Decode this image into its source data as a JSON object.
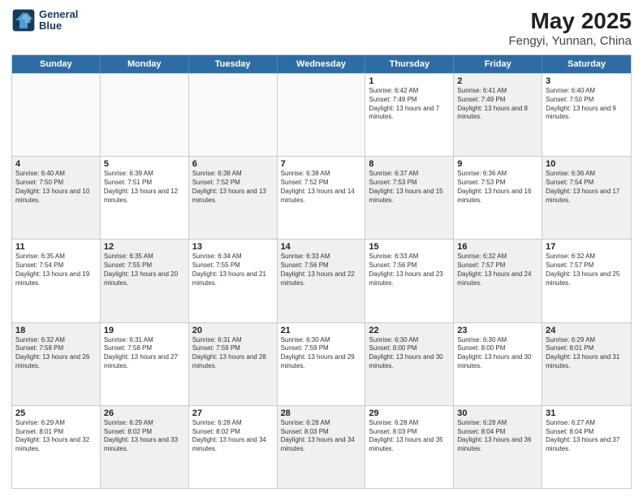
{
  "header": {
    "logo_line1": "General",
    "logo_line2": "Blue",
    "title": "May 2025",
    "subtitle": "Fengyi, Yunnan, China"
  },
  "weekdays": [
    "Sunday",
    "Monday",
    "Tuesday",
    "Wednesday",
    "Thursday",
    "Friday",
    "Saturday"
  ],
  "rows": [
    [
      {
        "day": "",
        "info": "",
        "empty": true
      },
      {
        "day": "",
        "info": "",
        "empty": true
      },
      {
        "day": "",
        "info": "",
        "empty": true
      },
      {
        "day": "",
        "info": "",
        "empty": true
      },
      {
        "day": "1",
        "info": "Sunrise: 6:42 AM\nSunset: 7:49 PM\nDaylight: 13 hours and 7 minutes.",
        "shaded": false
      },
      {
        "day": "2",
        "info": "Sunrise: 6:41 AM\nSunset: 7:49 PM\nDaylight: 13 hours and 8 minutes.",
        "shaded": true
      },
      {
        "day": "3",
        "info": "Sunrise: 6:40 AM\nSunset: 7:50 PM\nDaylight: 13 hours and 9 minutes.",
        "shaded": false
      }
    ],
    [
      {
        "day": "4",
        "info": "Sunrise: 6:40 AM\nSunset: 7:50 PM\nDaylight: 13 hours and 10 minutes.",
        "shaded": true
      },
      {
        "day": "5",
        "info": "Sunrise: 6:39 AM\nSunset: 7:51 PM\nDaylight: 13 hours and 12 minutes.",
        "shaded": false
      },
      {
        "day": "6",
        "info": "Sunrise: 6:38 AM\nSunset: 7:52 PM\nDaylight: 13 hours and 13 minutes.",
        "shaded": true
      },
      {
        "day": "7",
        "info": "Sunrise: 6:38 AM\nSunset: 7:52 PM\nDaylight: 13 hours and 14 minutes.",
        "shaded": false
      },
      {
        "day": "8",
        "info": "Sunrise: 6:37 AM\nSunset: 7:53 PM\nDaylight: 13 hours and 15 minutes.",
        "shaded": true
      },
      {
        "day": "9",
        "info": "Sunrise: 6:36 AM\nSunset: 7:53 PM\nDaylight: 13 hours and 16 minutes.",
        "shaded": false
      },
      {
        "day": "10",
        "info": "Sunrise: 6:36 AM\nSunset: 7:54 PM\nDaylight: 13 hours and 17 minutes.",
        "shaded": true
      }
    ],
    [
      {
        "day": "11",
        "info": "Sunrise: 6:35 AM\nSunset: 7:54 PM\nDaylight: 13 hours and 19 minutes.",
        "shaded": false
      },
      {
        "day": "12",
        "info": "Sunrise: 6:35 AM\nSunset: 7:55 PM\nDaylight: 13 hours and 20 minutes.",
        "shaded": true
      },
      {
        "day": "13",
        "info": "Sunrise: 6:34 AM\nSunset: 7:55 PM\nDaylight: 13 hours and 21 minutes.",
        "shaded": false
      },
      {
        "day": "14",
        "info": "Sunrise: 6:33 AM\nSunset: 7:56 PM\nDaylight: 13 hours and 22 minutes.",
        "shaded": true
      },
      {
        "day": "15",
        "info": "Sunrise: 6:33 AM\nSunset: 7:56 PM\nDaylight: 13 hours and 23 minutes.",
        "shaded": false
      },
      {
        "day": "16",
        "info": "Sunrise: 6:32 AM\nSunset: 7:57 PM\nDaylight: 13 hours and 24 minutes.",
        "shaded": true
      },
      {
        "day": "17",
        "info": "Sunrise: 6:32 AM\nSunset: 7:57 PM\nDaylight: 13 hours and 25 minutes.",
        "shaded": false
      }
    ],
    [
      {
        "day": "18",
        "info": "Sunrise: 6:32 AM\nSunset: 7:58 PM\nDaylight: 13 hours and 26 minutes.",
        "shaded": true
      },
      {
        "day": "19",
        "info": "Sunrise: 6:31 AM\nSunset: 7:58 PM\nDaylight: 13 hours and 27 minutes.",
        "shaded": false
      },
      {
        "day": "20",
        "info": "Sunrise: 6:31 AM\nSunset: 7:59 PM\nDaylight: 13 hours and 28 minutes.",
        "shaded": true
      },
      {
        "day": "21",
        "info": "Sunrise: 6:30 AM\nSunset: 7:59 PM\nDaylight: 13 hours and 29 minutes.",
        "shaded": false
      },
      {
        "day": "22",
        "info": "Sunrise: 6:30 AM\nSunset: 8:00 PM\nDaylight: 13 hours and 30 minutes.",
        "shaded": true
      },
      {
        "day": "23",
        "info": "Sunrise: 6:30 AM\nSunset: 8:00 PM\nDaylight: 13 hours and 30 minutes.",
        "shaded": false
      },
      {
        "day": "24",
        "info": "Sunrise: 6:29 AM\nSunset: 8:01 PM\nDaylight: 13 hours and 31 minutes.",
        "shaded": true
      }
    ],
    [
      {
        "day": "25",
        "info": "Sunrise: 6:29 AM\nSunset: 8:01 PM\nDaylight: 13 hours and 32 minutes.",
        "shaded": false
      },
      {
        "day": "26",
        "info": "Sunrise: 6:29 AM\nSunset: 8:02 PM\nDaylight: 13 hours and 33 minutes.",
        "shaded": true
      },
      {
        "day": "27",
        "info": "Sunrise: 6:28 AM\nSunset: 8:02 PM\nDaylight: 13 hours and 34 minutes.",
        "shaded": false
      },
      {
        "day": "28",
        "info": "Sunrise: 6:28 AM\nSunset: 8:03 PM\nDaylight: 13 hours and 34 minutes.",
        "shaded": true
      },
      {
        "day": "29",
        "info": "Sunrise: 6:28 AM\nSunset: 8:03 PM\nDaylight: 13 hours and 35 minutes.",
        "shaded": false
      },
      {
        "day": "30",
        "info": "Sunrise: 6:28 AM\nSunset: 8:04 PM\nDaylight: 13 hours and 36 minutes.",
        "shaded": true
      },
      {
        "day": "31",
        "info": "Sunrise: 6:27 AM\nSunset: 8:04 PM\nDaylight: 13 hours and 37 minutes.",
        "shaded": false
      }
    ]
  ]
}
